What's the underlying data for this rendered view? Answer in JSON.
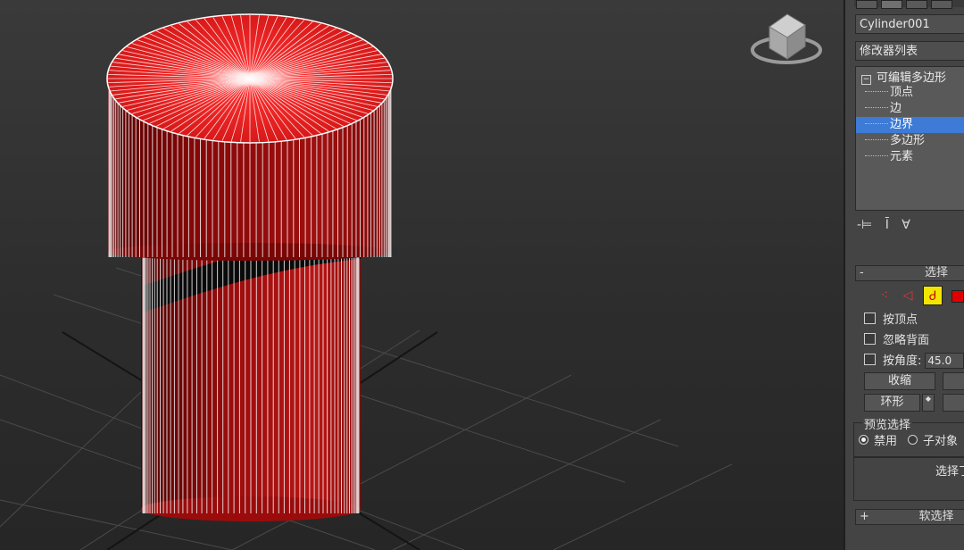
{
  "object_name": "Cylinder001",
  "modifier_list_label": "修改器列表",
  "modifier_stack": {
    "root": "可编辑多边形",
    "items": [
      {
        "label": "顶点",
        "selected": false
      },
      {
        "label": "边",
        "selected": false
      },
      {
        "label": "边界",
        "selected": true
      },
      {
        "label": "多边形",
        "selected": false
      },
      {
        "label": "元素",
        "selected": false
      }
    ]
  },
  "stack_tools": {
    "pin": "-⊨",
    "show_end": "Ī",
    "make_unique": "∀"
  },
  "select_rollout": {
    "toggle": "-",
    "title": "选择",
    "by_vertex": "按顶点",
    "ignore_backfacing": "忽略背面",
    "by_angle": "按角度:",
    "angle_value": "45.0",
    "shrink_button": "收缩",
    "ring_button": "环形",
    "ring_spinner": "◆",
    "preview_group_title": "预览选择",
    "preview_off": "禁用",
    "preview_subobject": "子对象",
    "selected_info": "选择了"
  },
  "soft_select_rollout": {
    "toggle": "+",
    "title": "软选择"
  },
  "colors": {
    "selection_highlight": "#3d7bd6",
    "active_subobject_icon": "#f2e600",
    "object_red": "#d11a1a"
  }
}
